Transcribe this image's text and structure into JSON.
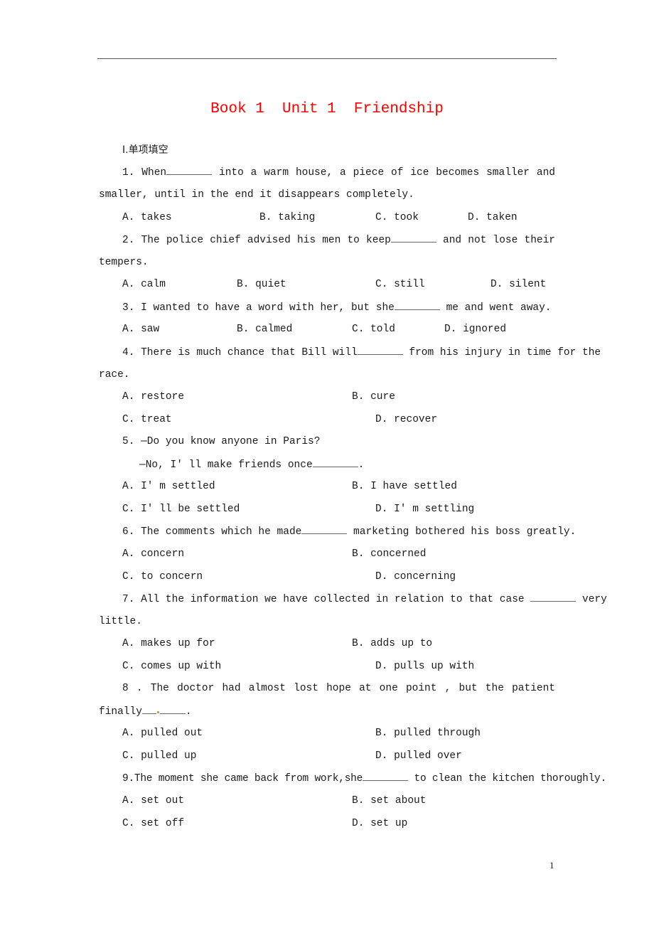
{
  "document": {
    "title": "Book 1  Unit 1  Friendship",
    "title_color": "#ff0000",
    "section": "Ⅰ.单项填空",
    "page_number": "1"
  },
  "questions": [
    {
      "number": "1.",
      "stem_parts": [
        "When",
        " into a warm house, a piece of ice becomes smaller and"
      ],
      "stem_cont": "smaller, until in the end it disappears completely.",
      "options": [
        "A. takes",
        "B. taking",
        "C. took",
        "D. taken"
      ]
    },
    {
      "number": "2.",
      "stem_parts": [
        "The police chief advised his men to keep",
        " and not lose their"
      ],
      "stem_cont": "tempers.",
      "options": [
        "A. calm",
        "B. quiet",
        "C. still",
        "D. silent"
      ]
    },
    {
      "number": "3.",
      "stem_parts": [
        "I wanted to have a word with her, but she",
        " me and went away."
      ],
      "options": [
        "A. saw",
        "B. calmed",
        "C. told",
        "D. ignored"
      ]
    },
    {
      "number": "4.",
      "stem_parts": [
        "There is much chance that Bill will",
        " from his injury in time for the"
      ],
      "stem_cont": "race.",
      "options": [
        "A. restore",
        "B. cure",
        "C. treat",
        "D. recover"
      ]
    },
    {
      "number": "5.",
      "stem_line1": "—Do you know anyone in Paris?",
      "stem_parts": [
        "—No, I' ll make friends once",
        "."
      ],
      "options": [
        "A. I' m settled",
        "B. I have settled",
        "C. I' ll be settled",
        "D. I' m settling"
      ]
    },
    {
      "number": "6.",
      "stem_parts": [
        "The comments which he made",
        " marketing bothered his boss greatly."
      ],
      "options": [
        "A. concern",
        "B. concerned",
        "C. to concern",
        "D. concerning"
      ]
    },
    {
      "number": "7.",
      "stem_parts": [
        "All the information we have collected in relation to that case ",
        " very"
      ],
      "stem_cont": "little.",
      "options": [
        "A. makes up for",
        "B. adds up to",
        "C. comes up with",
        "D. pulls up with"
      ]
    },
    {
      "number": "8 .",
      "stem_line1": "The doctor had almost lost hope at one point , but the patient",
      "stem_parts": [
        "finally",
        "."
      ],
      "options": [
        "A. pulled out",
        "B. pulled through",
        "C. pulled up",
        "D. pulled over"
      ]
    },
    {
      "number": "9.",
      "stem_parts": [
        "The moment she came back from work,she",
        " to clean the kitchen thoroughly."
      ],
      "options": [
        "A. set out",
        "B. set about",
        "C. set off",
        "D. set up"
      ]
    }
  ]
}
